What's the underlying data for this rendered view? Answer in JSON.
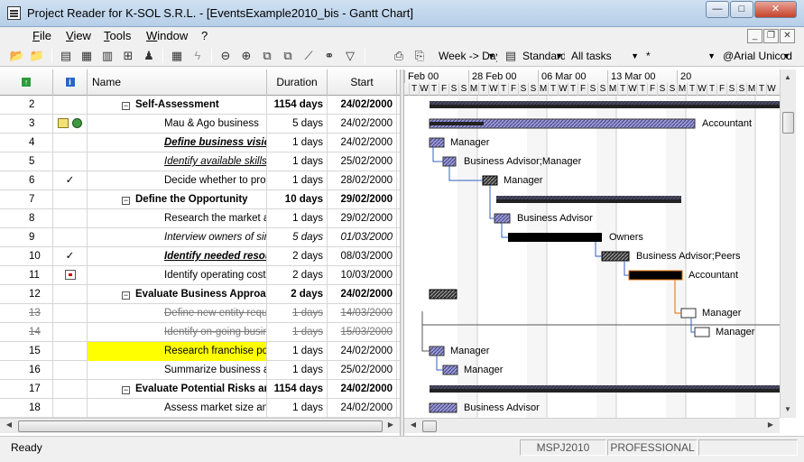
{
  "window": {
    "title": "Project Reader for K-SOL S.R.L. - [EventsExample2010_bis - Gantt Chart]",
    "minimize": "—",
    "maximize": "□",
    "close": "✕",
    "mdi_minimize": "_",
    "mdi_restore": "❐",
    "mdi_close": "✕"
  },
  "menu": {
    "items": [
      "File",
      "View",
      "Tools",
      "Window",
      "?"
    ]
  },
  "toolbar": {
    "icons": [
      "open-folder-icon",
      "open-file-icon",
      "gantt-view-icon",
      "calendar-view-icon",
      "table-view-icon",
      "resource-view-icon",
      "columns-icon",
      "lightning-icon",
      "zoom-out-icon",
      "zoom-in-icon",
      "copy-icon",
      "paste-icon",
      "chart-icon",
      "binoculars-icon",
      "filter-icon",
      "print-icon",
      "print-preview-icon"
    ],
    "timescale": "Week -> Day",
    "table": "Standard",
    "filter": "All tasks",
    "resource": "*",
    "font": "@Arial Unicode MS"
  },
  "grid": {
    "columns": {
      "name": "Name",
      "duration": "Duration",
      "start": "Start"
    },
    "rows": [
      {
        "id": "2",
        "indicator": "",
        "name": "Self-Assessment",
        "duration": "1154 days",
        "start": "24/02/2000",
        "level": 1,
        "summary": true
      },
      {
        "id": "3",
        "indicator": "notes",
        "name": "Mau & Ago business",
        "duration": "5 days",
        "start": "24/02/2000",
        "level": 2
      },
      {
        "id": "4",
        "indicator": "",
        "name": "Define business vision",
        "duration": "1 days",
        "start": "24/02/2000",
        "level": 2,
        "style": "bold-italic-underline"
      },
      {
        "id": "5",
        "indicator": "",
        "name": "Identify available skills, information and support",
        "duration": "1 days",
        "start": "25/02/2000",
        "level": 2,
        "style": "italic-underline"
      },
      {
        "id": "6",
        "indicator": "check",
        "name": "Decide whether to proceed",
        "duration": "1 days",
        "start": "28/02/2000",
        "level": 2
      },
      {
        "id": "7",
        "indicator": "",
        "name": "Define the Opportunity",
        "duration": "10 days",
        "start": "29/02/2000",
        "level": 1,
        "summary": true
      },
      {
        "id": "8",
        "indicator": "",
        "name": "Research the market and competition",
        "duration": "1 days",
        "start": "29/02/2000",
        "level": 2
      },
      {
        "id": "9",
        "indicator": "",
        "name": "Interview owners of similar businesses",
        "duration": "5 days",
        "start": "01/03/2000",
        "level": 2,
        "style": "italic"
      },
      {
        "id": "10",
        "indicator": "check",
        "name": "Identify needed resources",
        "duration": "2 days",
        "start": "08/03/2000",
        "level": 2,
        "style": "bold-italic-underline"
      },
      {
        "id": "11",
        "indicator": "calendar",
        "name": "Identify operating cost elements",
        "duration": "2 days",
        "start": "10/03/2000",
        "level": 2
      },
      {
        "id": "12",
        "indicator": "",
        "name": "Evaluate Business Approach",
        "duration": "2 days",
        "start": "24/02/2000",
        "level": 1,
        "summary": true
      },
      {
        "id": "13",
        "indicator": "",
        "name": "Define new entity requirements",
        "duration": "1 days",
        "start": "14/03/2000",
        "level": 2,
        "style": "strike"
      },
      {
        "id": "14",
        "indicator": "",
        "name": "Identify on-going business purchase opportunities",
        "duration": "1 days",
        "start": "15/03/2000",
        "level": 2,
        "style": "strike"
      },
      {
        "id": "15",
        "indicator": "",
        "name": "Research franchise possibilities",
        "duration": "1 days",
        "start": "24/02/2000",
        "level": 2,
        "highlight": true
      },
      {
        "id": "16",
        "indicator": "",
        "name": "Summarize business approach",
        "duration": "1 days",
        "start": "25/02/2000",
        "level": 2
      },
      {
        "id": "17",
        "indicator": "",
        "name": "Evaluate Potential Risks and Rewards",
        "duration": "1154 days",
        "start": "24/02/2000",
        "level": 1,
        "summary": true
      },
      {
        "id": "18",
        "indicator": "",
        "name": "Assess market size and stability",
        "duration": "1 days",
        "start": "24/02/2000",
        "level": 2
      }
    ]
  },
  "gantt": {
    "weeks": [
      "Feb 00",
      "28 Feb 00",
      "06 Mar 00",
      "13 Mar 00",
      "20"
    ],
    "days": [
      "T",
      "W",
      "T",
      "F",
      "S",
      "S",
      "M",
      "T",
      "W",
      "T",
      "F",
      "S",
      "S",
      "M",
      "T",
      "W",
      "T",
      "F",
      "S",
      "S",
      "M",
      "T",
      "W",
      "T",
      "F",
      "S",
      "S",
      "M",
      "T",
      "W",
      "T",
      "F",
      "S",
      "S",
      "M",
      "T",
      "W"
    ],
    "resource_labels": [
      "Accountant",
      "Manager",
      "Business Advisor;Manager",
      "Manager",
      "Business Advisor",
      "Owners",
      "Business Advisor;Peers",
      "Accountant",
      "Manager",
      "Manager",
      "Manager",
      "Manager",
      "Business Advisor"
    ]
  },
  "statusbar": {
    "status": "Ready",
    "version": "MSPJ2010",
    "edition": "PROFESSIONAL"
  },
  "colors": {
    "task_bar": "#8a8ad0",
    "critical_bar": "#000000",
    "summary_bar": "#222222",
    "highlight": "#ffff00",
    "link_blue": "#3060c0",
    "link_orange": "#e07000"
  }
}
